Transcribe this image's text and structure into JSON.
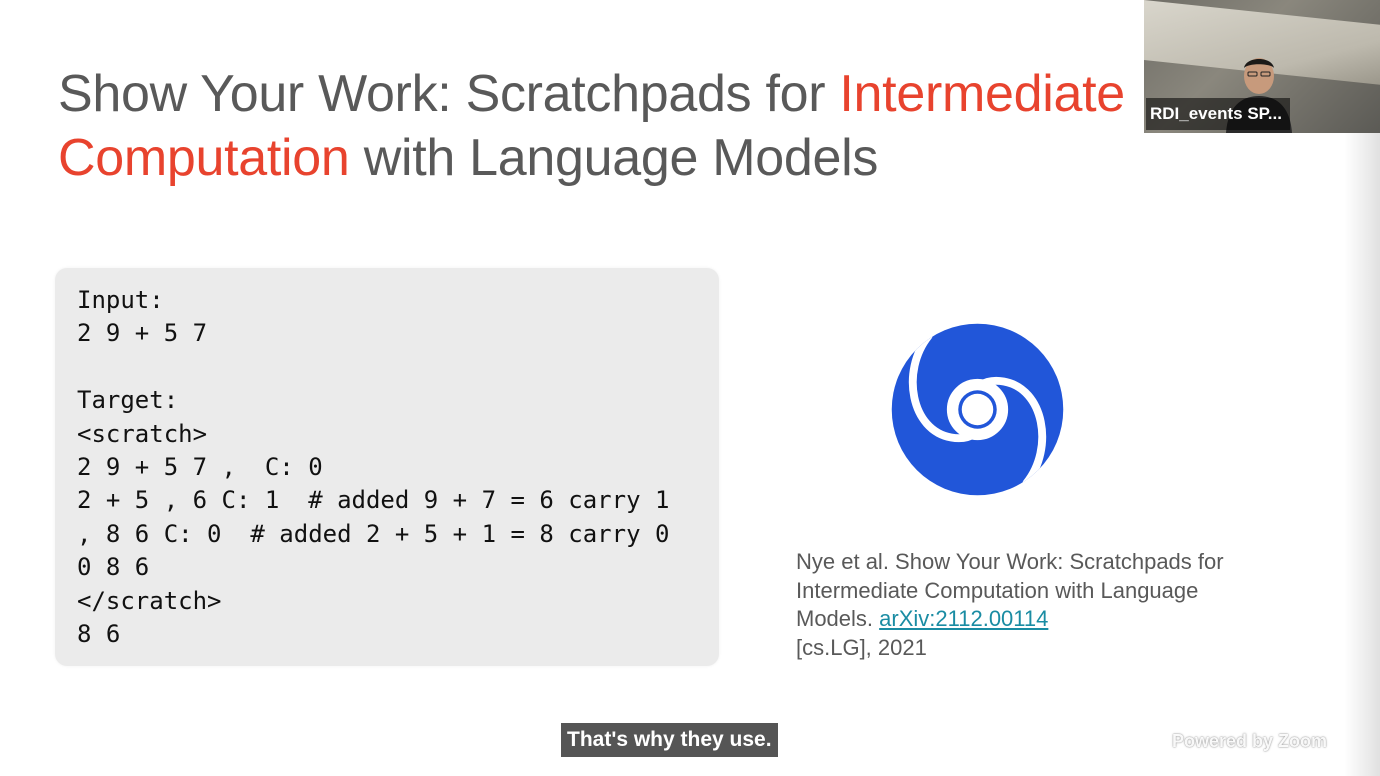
{
  "slide": {
    "title_part1": "Show Your Work: Scratchpads for ",
    "title_highlight1": "Intermediate",
    "title_highlight2": "Computation",
    "title_part2": " with Language Models",
    "code_lines": [
      "Input:",
      "2 9 + 5 7",
      "",
      "Target:",
      "<scratch>",
      "2 9 + 5 7 ,  C: 0",
      "2 + 5 , 6 C: 1  # added 9 + 7 = 6 carry 1",
      ", 8 6 C: 0  # added 2 + 5 + 1 = 8 carry 0",
      "0 8 6",
      "</scratch>",
      "8 6"
    ],
    "logo_icon": "deepmind-logo-icon",
    "citation_text": "Nye et al. Show Your Work: Scratchpads for Intermediate Computation with Language Models. ",
    "citation_link": "arXiv:2112.00114",
    "citation_suffix": "[cs.LG], 2021",
    "colors": {
      "title_gray": "#595959",
      "highlight_red": "#e8432e",
      "logo_blue": "#2156d9",
      "link_teal": "#1a8ca3",
      "code_bg": "#ebebeb"
    }
  },
  "participant": {
    "name": "RDI_events SP..."
  },
  "caption": {
    "text": "That's why they use."
  },
  "watermark": {
    "text": "Powered by Zoom"
  }
}
